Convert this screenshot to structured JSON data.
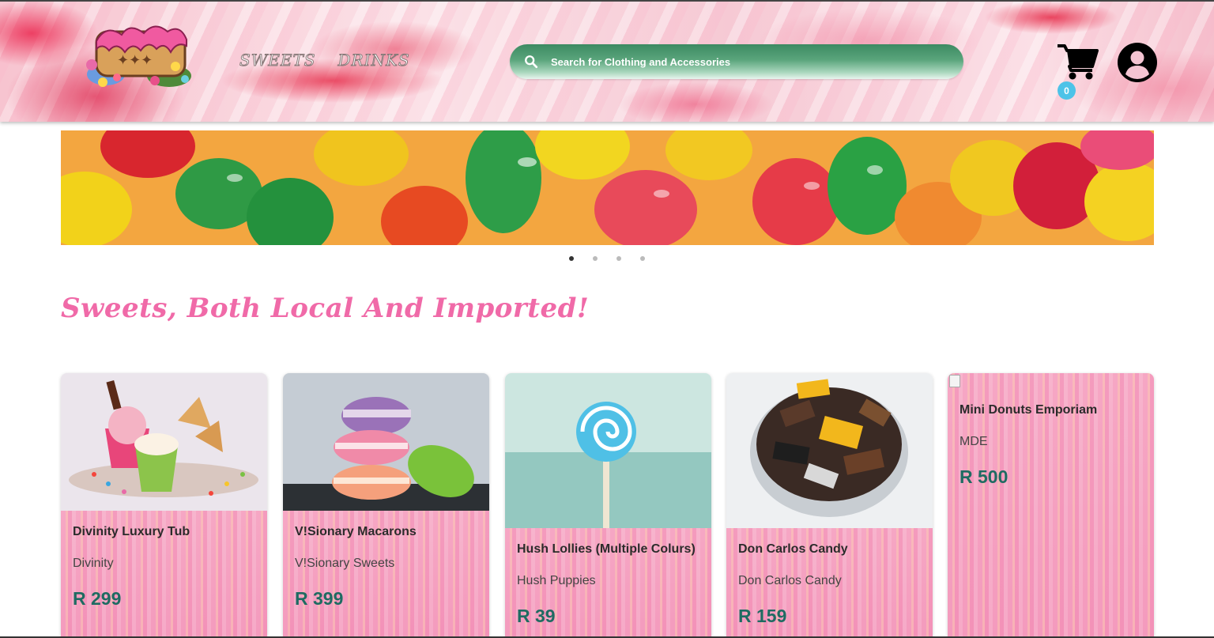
{
  "header": {
    "nav": [
      {
        "label": "SWEETS"
      },
      {
        "label": "DRINKS"
      }
    ],
    "search": {
      "placeholder": "Search for Clothing and Accessories"
    },
    "cart": {
      "count": "0"
    }
  },
  "carousel": {
    "slides": 4,
    "active_index": 0
  },
  "section": {
    "title": "Sweets, Both Local And Imported!"
  },
  "products": [
    {
      "name": "Divinity Luxury Tub",
      "brand": "Divinity",
      "price": "R 299"
    },
    {
      "name": "V!Sionary Macarons",
      "brand": "V!Sionary Sweets",
      "price": "R 399"
    },
    {
      "name": "Hush Lollies (Multiple Colurs)",
      "brand": "Hush Puppies",
      "price": "R 39"
    },
    {
      "name": "Don Carlos Candy",
      "brand": "Don Carlos Candy",
      "price": "R 159"
    },
    {
      "name": "Mini Donuts Emporiam",
      "brand": "MDE",
      "price": "R 500"
    }
  ],
  "colors": {
    "accent_pink": "#f06aa8",
    "price_teal": "#1f6b62",
    "search_green": "#3c8a62",
    "badge_blue": "#4dc3e8"
  }
}
